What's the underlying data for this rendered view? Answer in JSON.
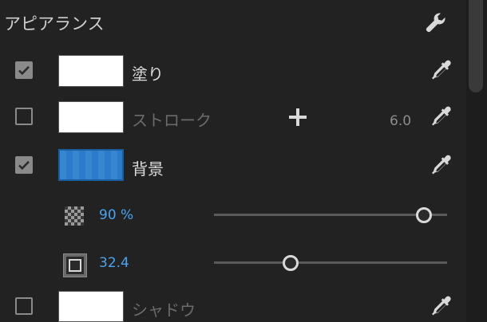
{
  "panel": {
    "title": "アピアランス",
    "settings_icon": "wrench-icon"
  },
  "rows": [
    {
      "label": "塗り",
      "checked": true,
      "swatch_color": "#ffffff",
      "enabled": true
    },
    {
      "label": "ストローク",
      "checked": false,
      "swatch_color": "#ffffff",
      "enabled": false,
      "value": "6.0"
    },
    {
      "label": "背景",
      "checked": true,
      "swatch_color": "#2b7fd0",
      "enabled": true
    },
    {
      "label": "シャドウ",
      "checked": false,
      "swatch_color": "#ffffff",
      "enabled": false
    }
  ],
  "background_settings": {
    "opacity": {
      "display": "90 %",
      "value": 0.9,
      "icon": "transparency-checker-icon"
    },
    "corner": {
      "display": "32.4",
      "value": 0.33,
      "icon": "corner-radius-icon"
    }
  },
  "colors": {
    "accent": "#4aa3ef",
    "background": "#222222"
  }
}
